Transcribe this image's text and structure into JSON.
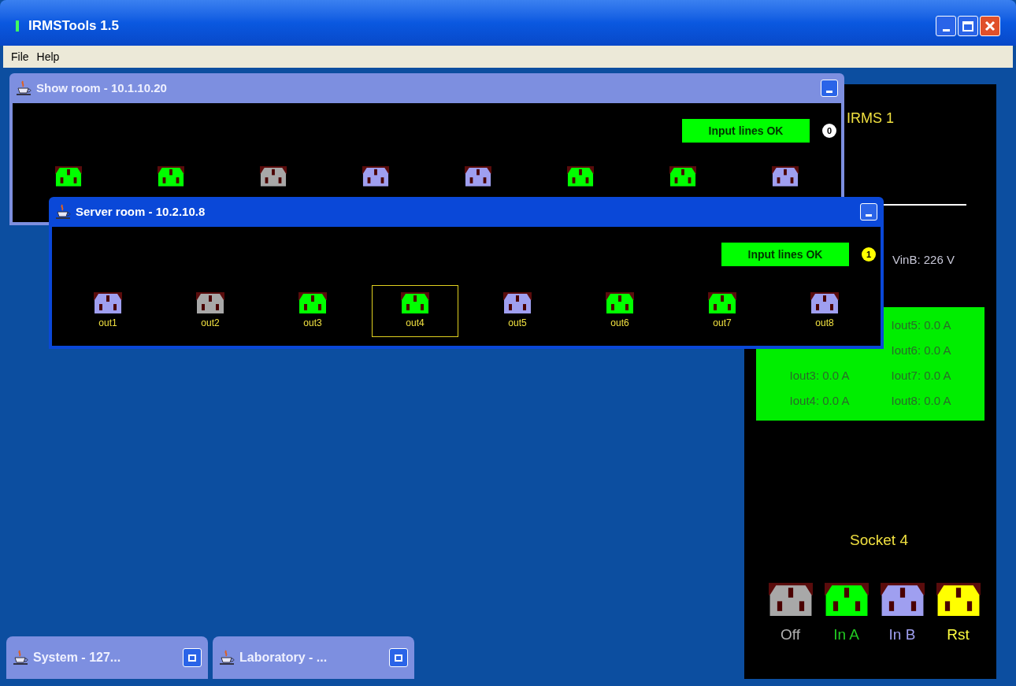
{
  "window": {
    "title": "IRMSTools 1.5"
  },
  "menu": [
    "File",
    "Help"
  ],
  "device_panel": {
    "title": "IRMS 1",
    "reading": "VinB: 226 V",
    "currents": [
      {
        "label": "Iout3: 0.0 A"
      },
      {
        "label": "Iout4: 0.0 A"
      },
      {
        "label": "Iout5: 0.0 A"
      },
      {
        "label": "Iout6: 0.0 A"
      },
      {
        "label": "Iout7: 0.0 A"
      },
      {
        "label": "Iout8: 0.0 A"
      }
    ],
    "socket_title": "Socket 4",
    "modes": [
      {
        "kind": "off",
        "label": "Off"
      },
      {
        "kind": "in_a",
        "label": "In A"
      },
      {
        "kind": "in_b",
        "label": "In B"
      },
      {
        "kind": "rst",
        "label": "Rst"
      }
    ]
  },
  "frames": [
    {
      "title": "Show room - 10.1.10.20",
      "active": false,
      "status": "Input lines OK",
      "badge": "0",
      "color": "#ffffff",
      "sockets": [
        {
          "kind": "in_a",
          "selected": false
        },
        {
          "kind": "in_a",
          "selected": false
        },
        {
          "kind": "off",
          "selected": false
        },
        {
          "kind": "in_b",
          "selected": false
        },
        {
          "kind": "in_b",
          "selected": false
        },
        {
          "kind": "in_a",
          "selected": false
        },
        {
          "kind": "in_a",
          "selected": false
        },
        {
          "kind": "in_b",
          "selected": false
        }
      ]
    },
    {
      "title": "Server room - 10.2.10.8",
      "active": true,
      "status": "Input lines OK",
      "badge": "1",
      "color": "#ffff00",
      "sockets": [
        {
          "kind": "in_b",
          "label": "out1",
          "selected": false
        },
        {
          "kind": "off",
          "label": "out2",
          "selected": false
        },
        {
          "kind": "in_a",
          "label": "out3",
          "selected": false
        },
        {
          "kind": "in_a",
          "label": "out4",
          "selected": true
        },
        {
          "kind": "in_b",
          "label": "out5",
          "selected": false
        },
        {
          "kind": "in_a",
          "label": "out6",
          "selected": false
        },
        {
          "kind": "in_a",
          "label": "out7",
          "selected": false
        },
        {
          "kind": "in_b",
          "label": "out8",
          "selected": false
        }
      ]
    }
  ],
  "minimized": [
    {
      "title": "System - 127..."
    },
    {
      "title": "Laboratory - ..."
    }
  ]
}
